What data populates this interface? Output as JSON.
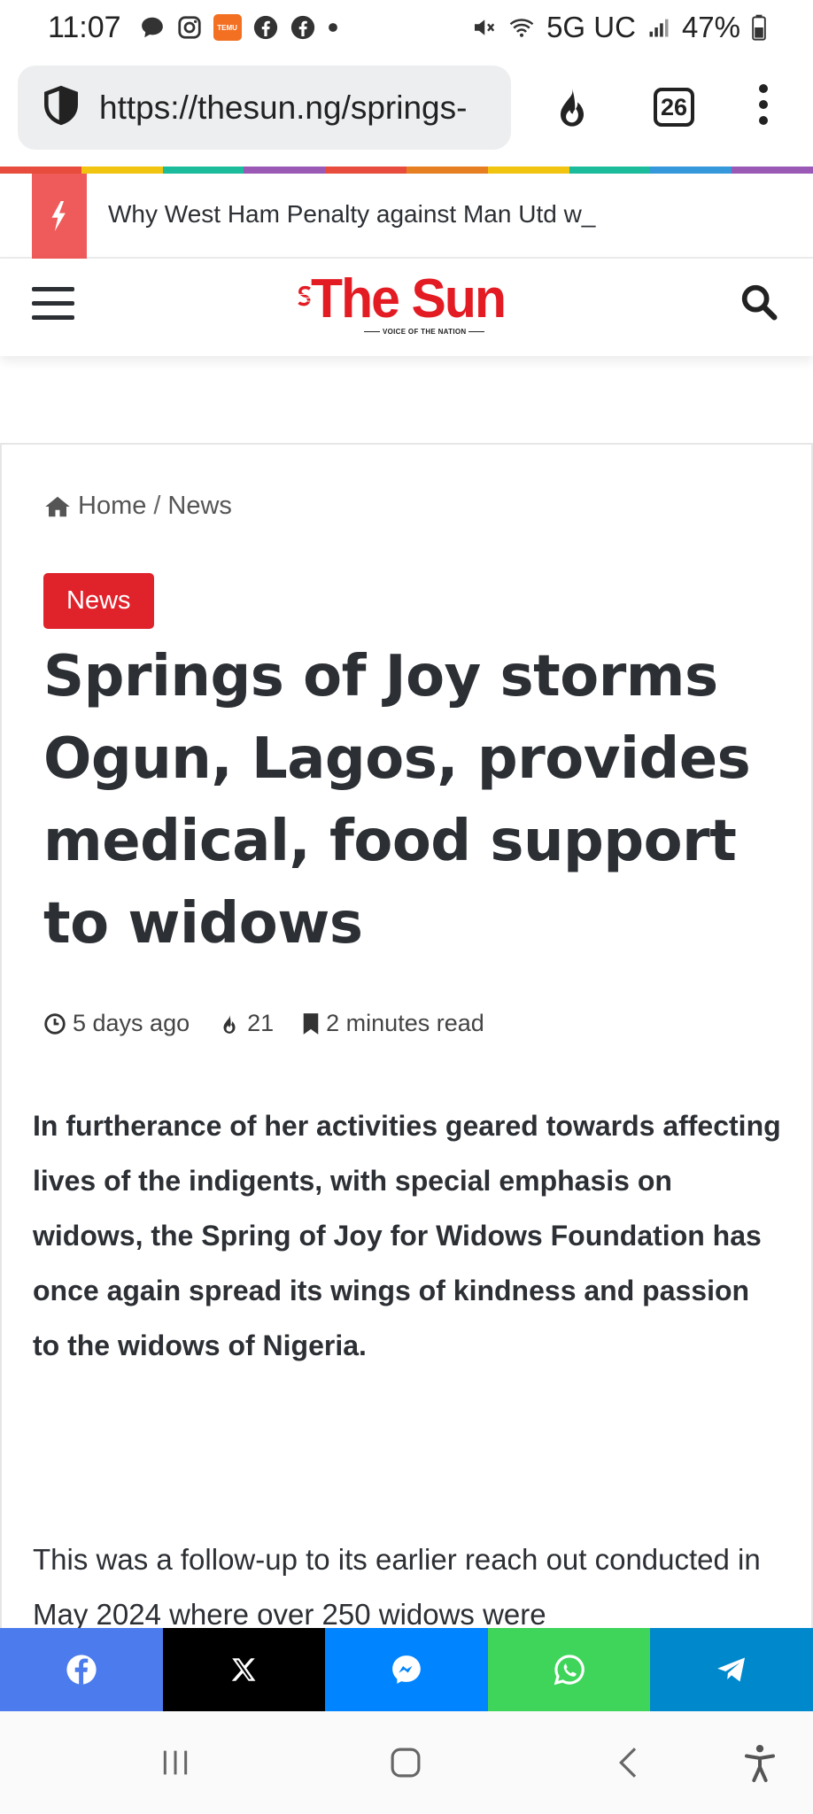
{
  "status_bar": {
    "time": "11:07",
    "temu_label": "TEMU",
    "network": "5G UC",
    "battery": "47%"
  },
  "browser": {
    "url": "https://thesun.ng/springs-",
    "tab_count": "26"
  },
  "rainbow_colors": [
    "#e74c3c",
    "#f1c40f",
    "#1abc9c",
    "#9b59b6",
    "#e74c3c",
    "#e67e22",
    "#f1c40f",
    "#1abc9c",
    "#3498db",
    "#9b59b6"
  ],
  "breaking": {
    "headline": "Why West Ham Penalty against Man Utd w_"
  },
  "site": {
    "logo_text": "The Sun",
    "tagline": "VOICE OF THE NATION",
    "brand_color": "#e31b23"
  },
  "breadcrumb": {
    "home": "Home",
    "separator": "/",
    "current": "News"
  },
  "article": {
    "category": "News",
    "title": "Springs of Joy storms Ogun, Lagos, provides medical, food support to widows",
    "time_ago": "5 days ago",
    "views": "21",
    "read_time": "2 minutes read",
    "lead": "In furtherance of her activities geared towards affecting lives of the indigents, with special emphasis on widows, the Spring of Joy for Widows Foundation has once again spread its wings of kindness and passion to the widows of Nigeria.",
    "paragraph": "This was a follow-up to its earlier reach out conducted in May 2024 where over 250 widows were"
  },
  "share_buttons": [
    {
      "icon": "facebook-icon",
      "color": "#4b7bec"
    },
    {
      "icon": "x-icon",
      "color": "#000000"
    },
    {
      "icon": "messenger-icon",
      "color": "#0084ff"
    },
    {
      "icon": "whatsapp-icon",
      "color": "#3fd55a"
    },
    {
      "icon": "telegram-icon",
      "color": "#0088cc"
    }
  ]
}
